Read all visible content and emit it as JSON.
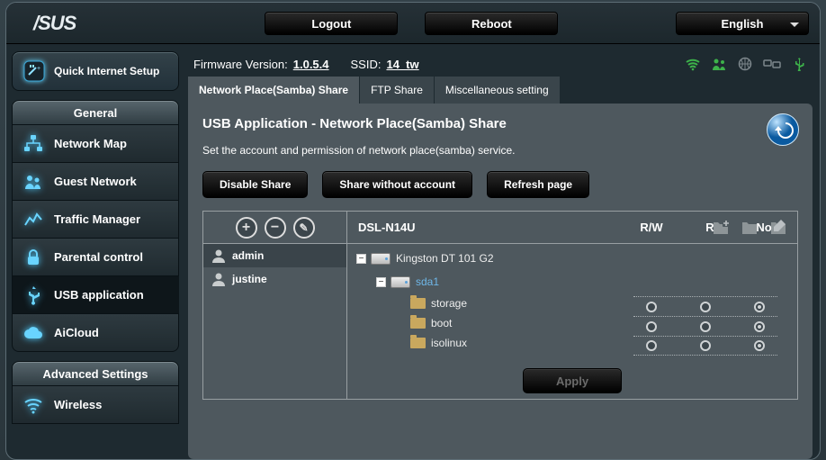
{
  "topbar": {
    "logout": "Logout",
    "reboot": "Reboot",
    "language": "English"
  },
  "sidebar": {
    "qis_label": "Quick Internet Setup",
    "general_header": "General",
    "advanced_header": "Advanced Settings",
    "general_items": [
      {
        "label": "Network Map"
      },
      {
        "label": "Guest Network"
      },
      {
        "label": "Traffic Manager"
      },
      {
        "label": "Parental control"
      },
      {
        "label": "USB application"
      },
      {
        "label": "AiCloud"
      }
    ],
    "advanced_items": [
      {
        "label": "Wireless"
      }
    ]
  },
  "status": {
    "fw_label": "Firmware Version:",
    "fw_value": "1.0.5.4",
    "ssid_label": "SSID:",
    "ssid_value": "14_tw"
  },
  "tabs": [
    {
      "label": "Network Place(Samba) Share"
    },
    {
      "label": "FTP Share"
    },
    {
      "label": "Miscellaneous setting"
    }
  ],
  "panel": {
    "title": "USB Application - Network Place(Samba) Share",
    "desc": "Set the account and permission of network place(samba) service.",
    "btn_disable": "Disable Share",
    "btn_noacct": "Share without account",
    "btn_refresh": "Refresh page",
    "apply": "Apply",
    "device": "DSL-N14U",
    "users": [
      "admin",
      "justine"
    ],
    "perm_headers": [
      "R/W",
      "R",
      "No"
    ],
    "disk_label": "Kingston DT 101 G2",
    "partition": "sda1",
    "folders": [
      "storage",
      "boot",
      "isolinux"
    ],
    "perms": [
      {
        "sel": "No"
      },
      {
        "sel": "No"
      },
      {
        "sel": "No"
      }
    ]
  }
}
